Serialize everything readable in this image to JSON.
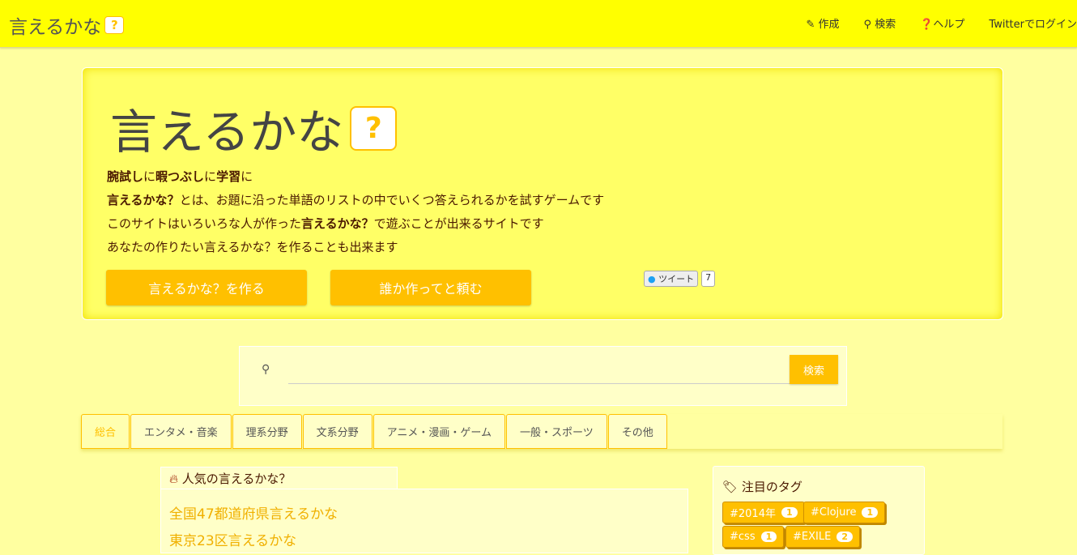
{
  "nav": {
    "brand": "言えるかな",
    "brand_mark": "?",
    "links": [
      {
        "icon": "pencil-icon",
        "glyph": "✎",
        "label": "作成"
      },
      {
        "icon": "search-icon",
        "glyph": "🔍",
        "label": "検索"
      },
      {
        "icon": "help-icon",
        "glyph": "❓",
        "label": "ヘルプ"
      },
      {
        "icon": "",
        "glyph": "",
        "label": "Twitterでログイン"
      }
    ]
  },
  "hero": {
    "title": "言えるかな",
    "title_mark": "?",
    "line1": [
      {
        "t": "腕試し",
        "b": true
      },
      {
        "t": "に",
        "b": false
      },
      {
        "t": "暇つぶし",
        "b": true
      },
      {
        "t": "に",
        "b": false
      },
      {
        "t": "学習",
        "b": true
      },
      {
        "t": "に",
        "b": false
      }
    ],
    "line2": [
      {
        "t": "言えるかな？",
        "b": true
      },
      {
        "t": "とは、お題に沿った単語のリストの中でいくつ答えられるかを試すゲームです",
        "b": false
      }
    ],
    "line3": [
      {
        "t": "このサイトはいろいろな人が作った",
        "b": false
      },
      {
        "t": "言えるかな？",
        "b": true
      },
      {
        "t": "で遊ぶことが出来るサイトです",
        "b": false
      }
    ],
    "line4": [
      {
        "t": "あなたの作りたい言えるかな？を作ることも出来ます",
        "b": false
      }
    ],
    "create_button": "言えるかな？を作る",
    "request_button": "誰か作ってと頼む",
    "tweet_label": "ツイート",
    "tweet_count": "7"
  },
  "search": {
    "placeholder": "",
    "button": "検索"
  },
  "tabs": [
    "総合",
    "エンタメ・音楽",
    "理系分野",
    "文系分野",
    "アニメ・漫画・ゲーム",
    "一般・スポーツ",
    "その他"
  ],
  "popular": {
    "heading": "人気の言えるかな？",
    "items": [
      "全国47都道府県言えるかな",
      "東京23区言えるかな"
    ]
  },
  "tags": {
    "heading": "注目のタグ",
    "items": [
      {
        "name": "#2014年",
        "count": "1"
      },
      {
        "name": "#Clojure",
        "count": "1"
      },
      {
        "name": "#css",
        "count": "1"
      },
      {
        "name": "#EXILE",
        "count": "2"
      }
    ]
  },
  "colors": {
    "header": "#ffff00",
    "background": "#ffffa0",
    "accent": "#ffc000",
    "text": "#4a1800"
  }
}
